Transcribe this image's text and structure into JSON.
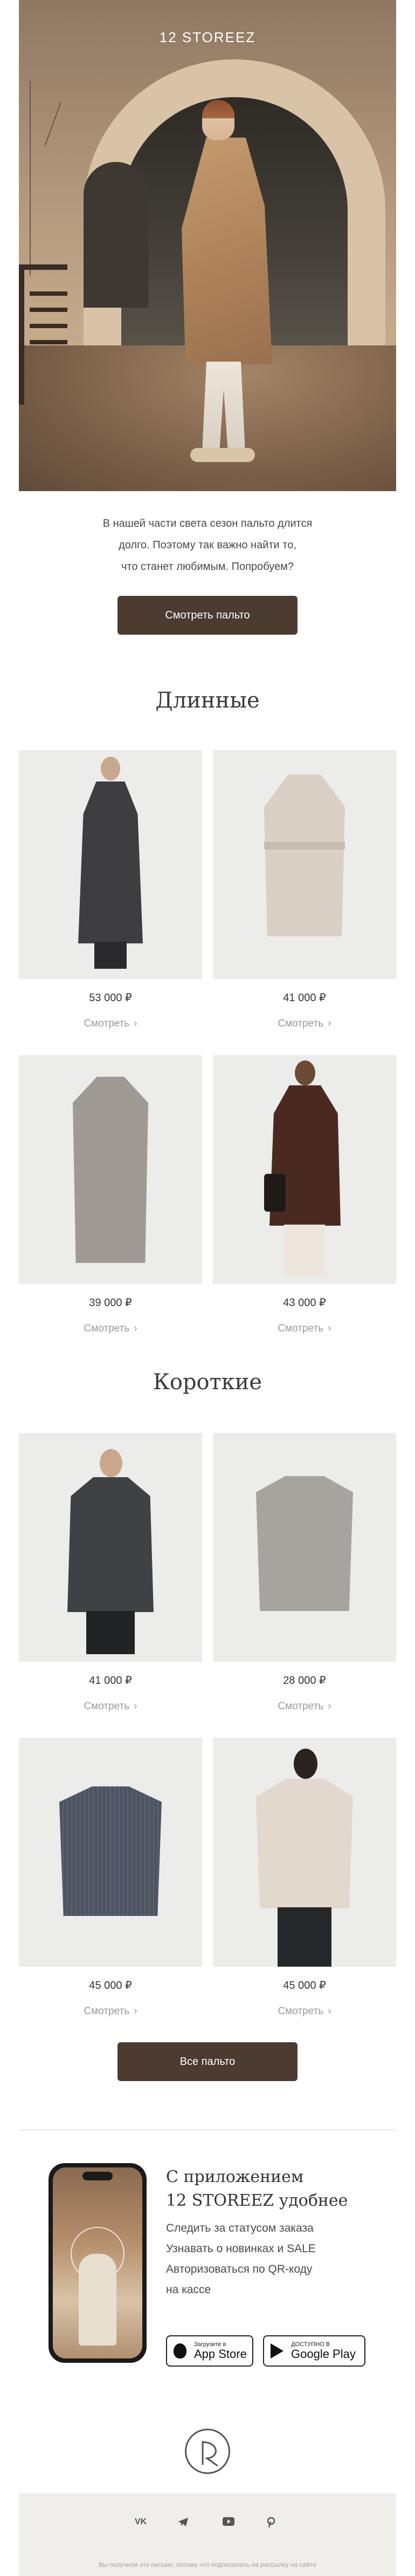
{
  "hero": {
    "brand": "12 STOREEZ"
  },
  "intro": {
    "line1": "В нашей части света сезон пальто длится",
    "line2": "долго. Поэтому так важно найти то,",
    "line3": "что станет любимым. Попробуем?",
    "button_label": "Смотреть пальто"
  },
  "sections": {
    "long": {
      "title": "Длинные",
      "products": [
        {
          "price": "53 000 ₽",
          "link_label": "Смотреть",
          "color": "#3e3e40"
        },
        {
          "price": "41 000 ₽",
          "link_label": "Смотреть",
          "color": "#d9cfc4"
        },
        {
          "price": "39 000 ₽",
          "link_label": "Смотреть",
          "color": "#a09a94"
        },
        {
          "price": "43 000 ₽",
          "link_label": "Смотреть",
          "color": "#4a2a20"
        }
      ]
    },
    "short": {
      "title": "Короткие",
      "products": [
        {
          "price": "41 000 ₽",
          "link_label": "Смотреть",
          "color": "#3f4144"
        },
        {
          "price": "28 000 ₽",
          "link_label": "Смотреть",
          "color": "#a7a39f"
        },
        {
          "price": "45 000 ₽",
          "link_label": "Смотреть",
          "color": "#4d5563"
        },
        {
          "price": "45 000 ₽",
          "link_label": "Смотреть",
          "color": "#e2d8cd"
        }
      ]
    },
    "all_button_label": "Все пальто"
  },
  "app": {
    "title_line1": "С приложением",
    "title_line2": "12 STOREEZ удобнее",
    "features": [
      "Следить за статусом заказа",
      "Узнавать о новинках и SALE",
      "Авторизоваться по QR-коду",
      "на кассе"
    ],
    "appstore_small": "Загрузите в",
    "appstore_big": "App Store",
    "googleplay_small": "ДОСТУПНО В",
    "googleplay_big": "Google Play"
  },
  "footer": {
    "socials": [
      "VK",
      "telegram-icon",
      "youtube-icon",
      "pinterest-icon"
    ],
    "vk_label": "VK",
    "note": "Вы получили это письмо, потому что подписались на рассылку на сайте"
  }
}
